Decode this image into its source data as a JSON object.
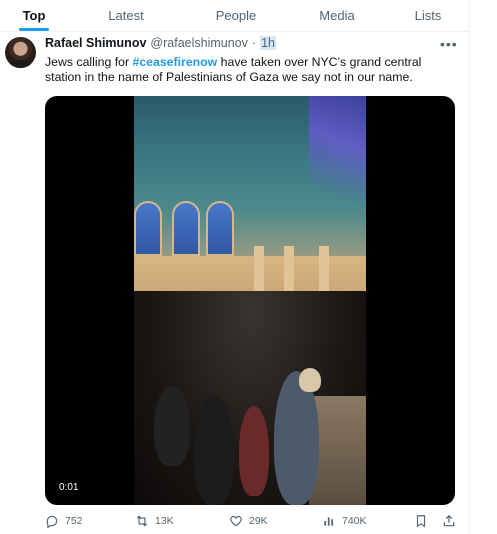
{
  "tabs": [
    {
      "label": "Top",
      "active": true
    },
    {
      "label": "Latest",
      "active": false
    },
    {
      "label": "People",
      "active": false
    },
    {
      "label": "Media",
      "active": false
    },
    {
      "label": "Lists",
      "active": false
    }
  ],
  "tweet": {
    "author_name": "Rafael Shimunov",
    "author_handle": "@rafaelshimunov",
    "separator": "·",
    "time": "1h",
    "more_icon": "more-horizontal-icon",
    "text_before": "Jews calling for ",
    "hashtag": "#ceasefirenow",
    "text_after": " have taken over NYC’s grand central station in the name of Palestinians of Gaza we say not in our name.",
    "video_duration": "0:01",
    "actions": {
      "replies": "752",
      "reposts": "13K",
      "likes": "29K",
      "views": "740K"
    }
  },
  "colors": {
    "accent": "#1d9bf0",
    "text_primary": "#0f1419",
    "text_secondary": "#536471"
  }
}
